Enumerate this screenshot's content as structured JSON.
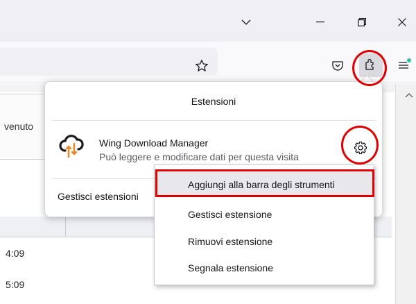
{
  "window": {
    "controls": [
      "chevron-down-icon",
      "minimize-icon",
      "restore-icon",
      "close-icon"
    ]
  },
  "toolbar": {
    "icons": [
      "bookmark-star-icon",
      "pocket-icon",
      "extensions-puzzle-icon",
      "app-menu-icon"
    ]
  },
  "page": {
    "tab_fragment": "venuto",
    "rows": [
      "4:09",
      "5:09"
    ]
  },
  "extensions_panel": {
    "title": "Estensioni",
    "extension": {
      "name": "Wing Download Manager",
      "description": "Può leggere e modificare dati per questa visita"
    },
    "manage_all": "Gestisci estensioni"
  },
  "context_menu": {
    "items": [
      "Aggiungi alla barra degli strumenti",
      "Gestisci estensione",
      "Rimuovi estensione",
      "Segnala estensione"
    ]
  },
  "colors": {
    "annotation_red": "#e00000",
    "menu_highlight": "#e8e8ec",
    "toolbar_bg": "#f9f9fb",
    "titlebar_bg": "#f0f0f4"
  }
}
